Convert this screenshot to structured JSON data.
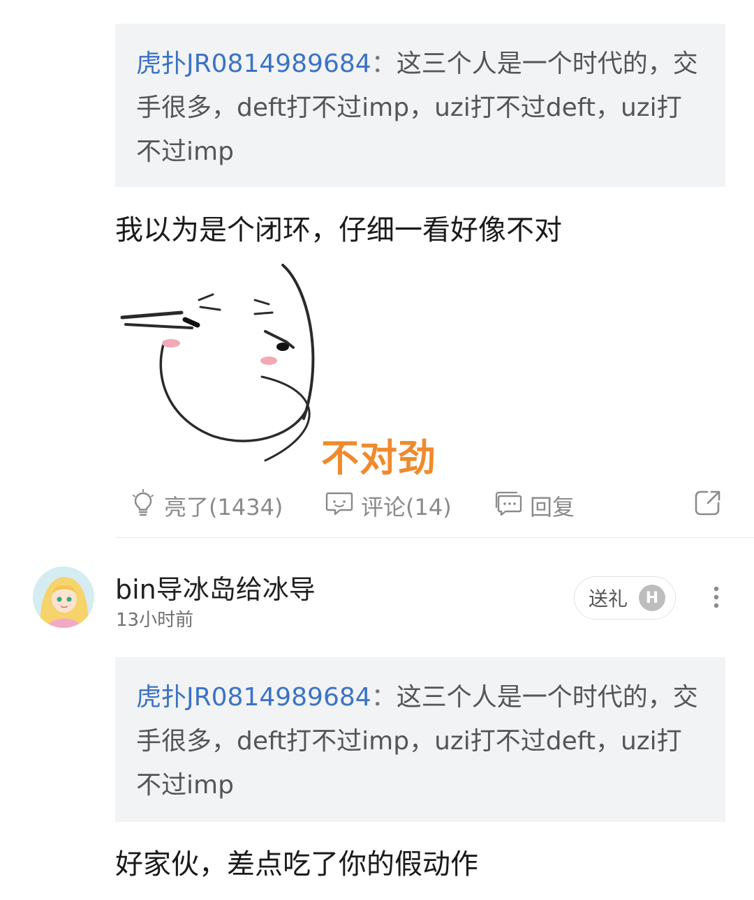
{
  "post1": {
    "quote": {
      "user": "虎扑JR0814989684",
      "separator": "：",
      "text": "这三个人是一个时代的，交手很多，deft打不过imp，uzi打不过deft，uzi打不过imp"
    },
    "body": "我以为是个闭环，仔细一看好像不对",
    "sticker_caption": "不对劲",
    "actions": {
      "like": "亮了(1434)",
      "comment": "评论(14)",
      "reply": "回复"
    }
  },
  "post2": {
    "username": "bin导冰岛给冰导",
    "timestamp": "13小时前",
    "gift_label": "送礼",
    "gift_coin": "H",
    "quote": {
      "user": "虎扑JR0814989684",
      "separator": "：",
      "text": "这三个人是一个时代的，交手很多，deft打不过imp，uzi打不过deft，uzi打不过imp"
    },
    "body": "好家伙，差点吃了你的假动作"
  },
  "colors": {
    "quote_user": "#3a73c4",
    "quote_bg": "#f2f3f5",
    "sticker_caption": "#f08a2c",
    "action_gray": "#8a8a8a"
  },
  "icons": [
    "lightbulb-icon",
    "comment-bubble-icon",
    "reply-icon",
    "share-icon",
    "more-vertical-icon"
  ]
}
